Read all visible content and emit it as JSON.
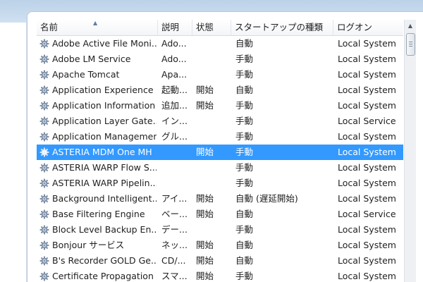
{
  "columns": {
    "name": "名前",
    "description": "説明",
    "status": "状態",
    "startup_type": "スタートアップの種類",
    "logon": "ログオン"
  },
  "icons": {
    "sort": "sort-ascending-icon",
    "service": "gear-icon",
    "scroll_up": "scroll-up-arrow-icon"
  },
  "colors": {
    "selection": "#3399ff"
  },
  "services": [
    {
      "name": "Adobe Active File Moni...",
      "description": "Ado...",
      "status": "",
      "startup": "自動",
      "logon": "Local System"
    },
    {
      "name": "Adobe LM Service",
      "description": "Ado...",
      "status": "",
      "startup": "手動",
      "logon": "Local System"
    },
    {
      "name": "Apache Tomcat",
      "description": "Apa...",
      "status": "",
      "startup": "手動",
      "logon": "Local System"
    },
    {
      "name": "Application Experience",
      "description": "起動...",
      "status": "開始",
      "startup": "自動",
      "logon": "Local System"
    },
    {
      "name": "Application Information",
      "description": "追加...",
      "status": "開始",
      "startup": "手動",
      "logon": "Local System"
    },
    {
      "name": "Application Layer Gate...",
      "description": "イン...",
      "status": "",
      "startup": "手動",
      "logon": "Local Service"
    },
    {
      "name": "Application Management",
      "description": "グル...",
      "status": "",
      "startup": "手動",
      "logon": "Local System"
    },
    {
      "name": "ASTERIA MDM One MH",
      "description": "",
      "status": "開始",
      "startup": "手動",
      "logon": "Local System",
      "selected": true
    },
    {
      "name": "ASTERIA WARP Flow S...",
      "description": "",
      "status": "",
      "startup": "手動",
      "logon": "Local System"
    },
    {
      "name": "ASTERIA WARP Pipelin...",
      "description": "",
      "status": "",
      "startup": "手動",
      "logon": "Local System"
    },
    {
      "name": "Background Intelligent...",
      "description": "アイ...",
      "status": "開始",
      "startup": "自動 (遅延開始)",
      "logon": "Local System"
    },
    {
      "name": "Base Filtering Engine",
      "description": "ベー...",
      "status": "開始",
      "startup": "自動",
      "logon": "Local Service"
    },
    {
      "name": "Block Level Backup En...",
      "description": "デー...",
      "status": "",
      "startup": "手動",
      "logon": "Local System"
    },
    {
      "name": "Bonjour サービス",
      "description": "ネッ...",
      "status": "開始",
      "startup": "自動",
      "logon": "Local System"
    },
    {
      "name": "B's Recorder GOLD Ge...",
      "description": "CD/...",
      "status": "開始",
      "startup": "自動",
      "logon": "Local System"
    },
    {
      "name": "Certificate Propagation",
      "description": "スマ...",
      "status": "開始",
      "startup": "手動",
      "logon": "Local System"
    }
  ]
}
